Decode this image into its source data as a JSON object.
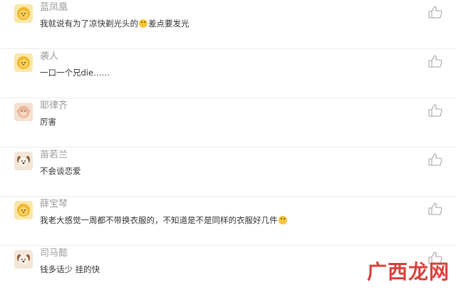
{
  "comments": [
    {
      "user": "蓝凤凰",
      "text": "我就说有为了凉快剃光头的",
      "emoji": "cool-face-emoji",
      "text_after": "差点要发光",
      "avatar": "lion-avatar"
    },
    {
      "user": "袭人",
      "text": "一口一个兄die……",
      "emoji": "",
      "text_after": "",
      "avatar": "lion-avatar"
    },
    {
      "user": "耶律齐",
      "text": "厉害",
      "emoji": "",
      "text_after": "",
      "avatar": "monkey-avatar"
    },
    {
      "user": "苗若兰",
      "text": "不会谈恋爱",
      "emoji": "",
      "text_after": "",
      "avatar": "dog-avatar"
    },
    {
      "user": "薛宝琴",
      "text": "我老大感觉一周都不带换衣服的，不知道是不是同样的衣服好几件",
      "emoji": "laughing-emoji",
      "text_after": "",
      "avatar": "lion-avatar"
    },
    {
      "user": "司马懿",
      "text": "钱多话少 挂的快",
      "emoji": "",
      "text_after": "",
      "avatar": "dog-avatar"
    }
  ],
  "watermark": "广西龙网",
  "colors": {
    "username": "#9a9a9a",
    "text": "#333333",
    "watermark": "#d9302a",
    "lion_bg": "#f7d26a"
  }
}
